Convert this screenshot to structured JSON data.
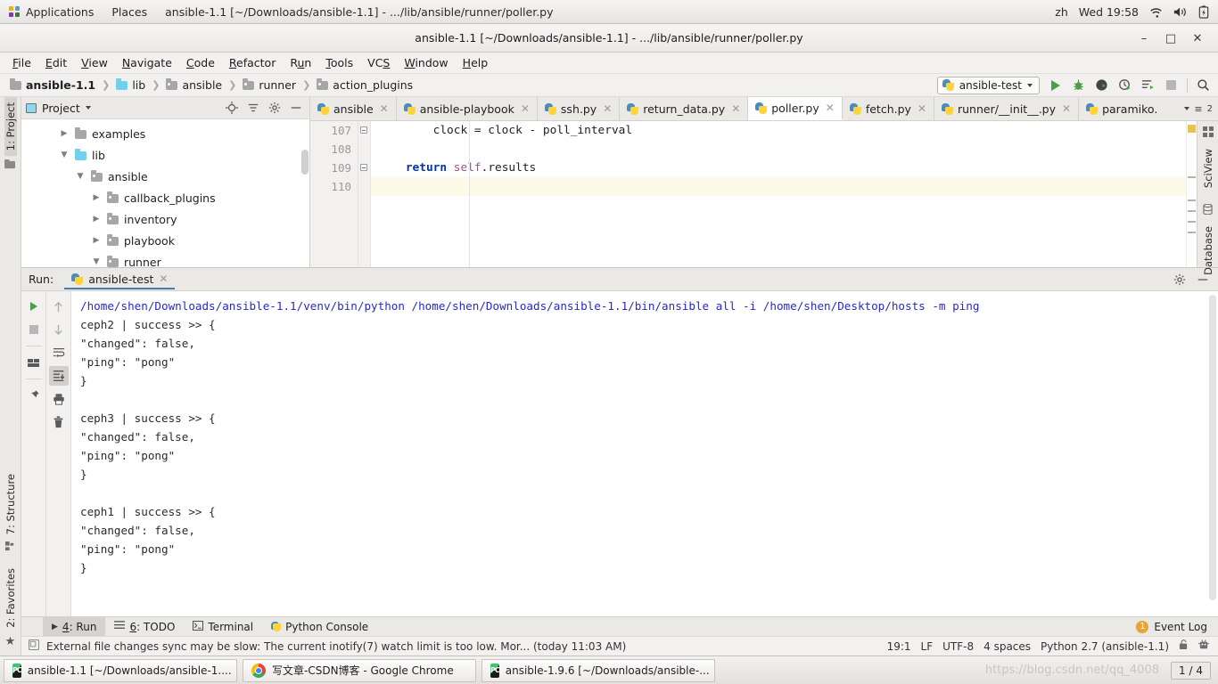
{
  "gnome": {
    "applications": "Applications",
    "places": "Places",
    "window_title": "ansible-1.1 [~/Downloads/ansible-1.1] - .../lib/ansible/runner/poller.py",
    "input_method": "zh",
    "clock": "Wed 19:58"
  },
  "window": {
    "title": "ansible-1.1 [~/Downloads/ansible-1.1] - .../lib/ansible/runner/poller.py",
    "minimize": "–",
    "maximize": "□",
    "close": "✕"
  },
  "menubar": {
    "items": [
      "File",
      "Edit",
      "View",
      "Navigate",
      "Code",
      "Refactor",
      "Run",
      "Tools",
      "VCS",
      "Window",
      "Help"
    ]
  },
  "breadcrumb": {
    "items": [
      {
        "label": "ansible-1.1",
        "icon": "folder-icon",
        "bold": true,
        "color": "#a6a6a6"
      },
      {
        "label": "lib",
        "icon": "folder-icon",
        "bold": false,
        "color": "#73d0ec"
      },
      {
        "label": "ansible",
        "icon": "source-folder-icon",
        "bold": false,
        "color": "#a6a6a6"
      },
      {
        "label": "runner",
        "icon": "source-folder-icon",
        "bold": false,
        "color": "#a6a6a6"
      },
      {
        "label": "action_plugins",
        "icon": "source-folder-icon",
        "bold": false,
        "color": "#a6a6a6"
      }
    ]
  },
  "toolbar": {
    "run_config": "ansible-test",
    "run_tooltip": "Run",
    "debug_tooltip": "Debug",
    "coverage_tooltip": "Run with Coverage",
    "profile_tooltip": "Profile",
    "rerun_tooltip": "Rerun",
    "stop_tooltip": "Stop",
    "search_tooltip": "Search Everywhere"
  },
  "project_panel": {
    "title": "Project",
    "tree": [
      {
        "label": "examples",
        "depth": 1,
        "expanded": false,
        "arrow": "▶",
        "icon": "folder-icon",
        "color": "#a6a6a6"
      },
      {
        "label": "lib",
        "depth": 1,
        "expanded": true,
        "arrow": "▼",
        "icon": "folder-icon",
        "color": "#73d0ec"
      },
      {
        "label": "ansible",
        "depth": 2,
        "expanded": true,
        "arrow": "▼",
        "icon": "source-folder-icon",
        "color": "#a6a6a6"
      },
      {
        "label": "callback_plugins",
        "depth": 3,
        "expanded": false,
        "arrow": "▶",
        "icon": "source-folder-icon",
        "color": "#a6a6a6"
      },
      {
        "label": "inventory",
        "depth": 3,
        "expanded": false,
        "arrow": "▶",
        "icon": "source-folder-icon",
        "color": "#a6a6a6"
      },
      {
        "label": "playbook",
        "depth": 3,
        "expanded": false,
        "arrow": "▶",
        "icon": "source-folder-icon",
        "color": "#a6a6a6"
      },
      {
        "label": "runner",
        "depth": 3,
        "expanded": true,
        "arrow": "▼",
        "icon": "source-folder-icon",
        "color": "#a6a6a6"
      }
    ]
  },
  "left_strip": {
    "project_tab": "1: Project",
    "structure_tab": "7: Structure",
    "favorites_tab": "2: Favorites"
  },
  "right_strip": {
    "sciview_tab": "SciView",
    "database_tab": "Database"
  },
  "editor": {
    "tabs": [
      {
        "label": "ansible",
        "active": false
      },
      {
        "label": "ansible-playbook",
        "active": false
      },
      {
        "label": "ssh.py",
        "active": false
      },
      {
        "label": "return_data.py",
        "active": false
      },
      {
        "label": "poller.py",
        "active": true
      },
      {
        "label": "fetch.py",
        "active": false
      },
      {
        "label": "runner/__init__.py",
        "active": false
      },
      {
        "label": "paramiko.",
        "active": false
      }
    ],
    "overflow_count": "2",
    "lines": [
      {
        "number": "107",
        "text": "        clock = clock - poll_interval",
        "highlight": false,
        "fold": true
      },
      {
        "number": "108",
        "text": "",
        "highlight": false,
        "fold": false
      },
      {
        "number": "109",
        "text": "    return self.results",
        "highlight": false,
        "fold": true,
        "tokens": [
          {
            "t": "    ",
            "c": "plain"
          },
          {
            "t": "return",
            "c": "kw"
          },
          {
            "t": " ",
            "c": "plain"
          },
          {
            "t": "self",
            "c": "self"
          },
          {
            "t": ".results",
            "c": "plain"
          }
        ]
      },
      {
        "number": "110",
        "text": "",
        "highlight": true,
        "fold": false
      }
    ]
  },
  "run_window": {
    "label": "Run:",
    "tab_label": "ansible-test",
    "settings_tooltip": "Settings",
    "hide_tooltip": "Hide",
    "console": [
      {
        "text": "/home/shen/Downloads/ansible-1.1/venv/bin/python /home/shen/Downloads/ansible-1.1/bin/ansible all -i /home/shen/Desktop/hosts -m ping",
        "style": "cmd"
      },
      {
        "text": "ceph2 | success >> {",
        "style": "out"
      },
      {
        "text": "    \"changed\": false, ",
        "style": "out"
      },
      {
        "text": "    \"ping\": \"pong\"",
        "style": "out"
      },
      {
        "text": "}",
        "style": "out"
      },
      {
        "text": "",
        "style": "out"
      },
      {
        "text": "ceph3 | success >> {",
        "style": "out"
      },
      {
        "text": "    \"changed\": false, ",
        "style": "out"
      },
      {
        "text": "    \"ping\": \"pong\"",
        "style": "out"
      },
      {
        "text": "}",
        "style": "out"
      },
      {
        "text": "",
        "style": "out"
      },
      {
        "text": "ceph1 | success >> {",
        "style": "out"
      },
      {
        "text": "    \"changed\": false, ",
        "style": "out"
      },
      {
        "text": "    \"ping\": \"pong\"",
        "style": "out"
      },
      {
        "text": "}",
        "style": "out"
      }
    ],
    "side_buttons": [
      "rerun-icon",
      "stop-icon",
      "restore-layout-icon",
      "pin-icon",
      "up-arrow-icon",
      "down-arrow-icon",
      "soft-wrap-icon",
      "scroll-to-end-icon",
      "print-icon",
      "trash-icon"
    ]
  },
  "bottom_tabs": {
    "items": [
      {
        "label": "4: Run",
        "selected": true,
        "icon": "play-icon"
      },
      {
        "label": "6: TODO",
        "selected": false,
        "icon": "list-icon"
      },
      {
        "label": "Terminal",
        "selected": false,
        "icon": "terminal-icon"
      },
      {
        "label": "Python Console",
        "selected": false,
        "icon": "python-icon"
      }
    ],
    "event_log": "Event Log",
    "event_badge": "1"
  },
  "status_bar": {
    "message": "External file changes sync may be slow: The current inotify(7) watch limit is too low. Mor... (today 11:03 AM)",
    "caret": "19:1",
    "line_sep": "LF",
    "encoding": "UTF-8",
    "indent": "4 spaces",
    "interpreter": "Python 2.7 (ansible-1.1)",
    "lock_icon": "lock-icon",
    "inspection_icon": "inspector-icon"
  },
  "taskbar": {
    "items": [
      {
        "label": "ansible-1.1 [~/Downloads/ansible-1....",
        "icon": "pycharm-icon"
      },
      {
        "label": "写文章-CSDN博客 - Google Chrome",
        "icon": "chrome-icon"
      },
      {
        "label": "ansible-1.9.6 [~/Downloads/ansible-...",
        "icon": "pycharm-icon"
      }
    ],
    "watermark": "https://blog.csdn.net/qq_4008",
    "pager": "1 / 4"
  }
}
